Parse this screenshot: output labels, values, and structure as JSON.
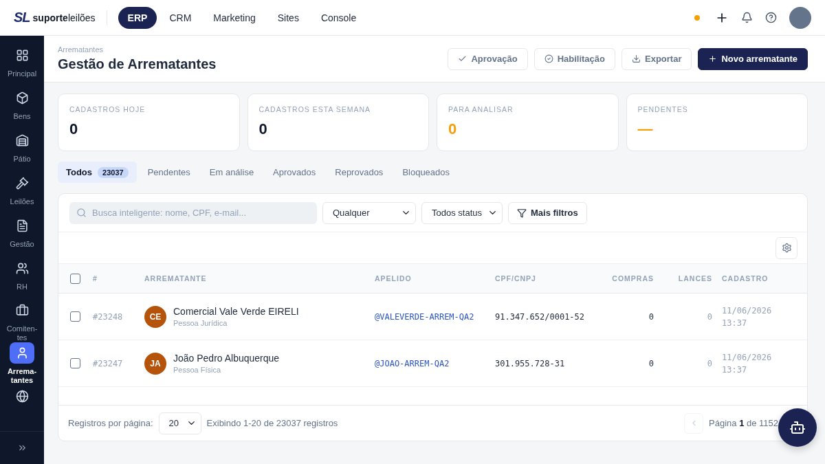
{
  "brand": {
    "mark": "SL",
    "name": "**suporte**leilões"
  },
  "top_nav": [
    {
      "label": "ERP",
      "selected": true
    },
    {
      "label": "CRM",
      "selected": false
    },
    {
      "label": "Marketing",
      "selected": false
    },
    {
      "label": "Sites",
      "selected": false
    },
    {
      "label": "Console",
      "selected": false
    }
  ],
  "status_dot": {
    "color": "#f59e0b"
  },
  "sidebar": {
    "items": [
      {
        "kind": "grid",
        "label": "Principal",
        "selected": false
      },
      {
        "kind": "box",
        "label": "Bens",
        "selected": false
      },
      {
        "kind": "warehouse",
        "label": "Pátio",
        "selected": false
      },
      {
        "kind": "gavel",
        "label": "Leilões",
        "selected": false
      },
      {
        "kind": "file",
        "label": "Gestão",
        "selected": false
      },
      {
        "kind": "users",
        "label": "RH",
        "selected": false
      },
      {
        "kind": "briefcase",
        "label": "Comiten-tes",
        "selected": false
      },
      {
        "kind": "user",
        "label": "Arrema-tantes",
        "selected": true
      },
      {
        "kind": "globe",
        "selected": false
      }
    ]
  },
  "header": {
    "breadcrumb": "Arrematantes",
    "title": "Gestão de Arrematantes",
    "actions": [
      {
        "kind": "check",
        "label": "Aprovação",
        "primary": false
      },
      {
        "kind": "circle-check",
        "label": "Habilitação",
        "primary": false
      },
      {
        "kind": "download",
        "label": "Exportar",
        "primary": false
      },
      {
        "kind": "plus",
        "label": "Novo arrematante",
        "primary": true
      }
    ]
  },
  "stats": [
    {
      "label": "CADASTROS HOJE",
      "value": "0",
      "highlighted": false
    },
    {
      "label": "CADASTROS ESTA SEMANA",
      "value": "0",
      "highlighted": false
    },
    {
      "label": "PARA ANALISAR",
      "value": "0",
      "highlighted": true
    },
    {
      "label": "PENDENTES",
      "value": "—",
      "highlighted": true
    }
  ],
  "tabs": [
    {
      "label": "Todos",
      "count": "23037",
      "selected": true
    },
    {
      "label": "Pendentes",
      "selected": false
    },
    {
      "label": "Em análise",
      "selected": false
    },
    {
      "label": "Aprovados",
      "selected": false
    },
    {
      "label": "Reprovados",
      "selected": false
    },
    {
      "label": "Bloqueados",
      "selected": false
    }
  ],
  "filters": {
    "search": {
      "placeholder": "Busca inteligente: nome, CPF, e-mail..."
    },
    "type_select": "Qualquer",
    "status_select": "Todos status",
    "more": "Mais filtros"
  },
  "table": {
    "all_checked": false,
    "columns": [
      "#",
      "ARREMATANTE",
      "APELIDO",
      "CPF/CNPJ",
      "COMPRAS",
      "LANCES",
      "CADASTRO"
    ],
    "rows": [
      {
        "checked": false,
        "id": "#23248",
        "initials": "CE",
        "name": "Comercial Vale Verde EIRELI",
        "type": "Pessoa Jurídica",
        "nickname": "@VALEVERDE-ARREM-QA2",
        "document": "91.347.652/0001-52",
        "purchases": "0",
        "bids": "0",
        "date": "11/06/2026",
        "time": "13:37"
      },
      {
        "checked": false,
        "id": "#23247",
        "initials": "JA",
        "name": "João Pedro Albuquerque",
        "type": "Pessoa Física",
        "nickname": "@JOAO-ARREM-QA2",
        "document": "301.955.728-31",
        "purchases": "0",
        "bids": "0",
        "date": "11/06/2026",
        "time": "13:37"
      }
    ]
  },
  "footer": {
    "per_page_label": "Registros por página:",
    "per_page": "20",
    "summary": "Exibindo 1-20 de 23037 registros",
    "page": "Página **1** de 1152"
  }
}
